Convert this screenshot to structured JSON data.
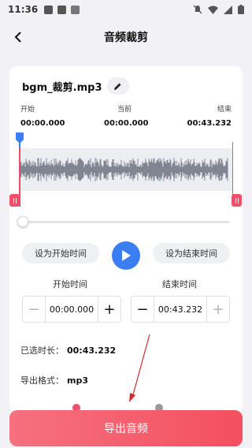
{
  "status_bar": {
    "time": "11:36"
  },
  "header": {
    "title": "音频裁剪"
  },
  "file": {
    "name": "bgm_裁剪.mp3"
  },
  "timeline": {
    "start_label": "开始",
    "current_label": "当前",
    "end_label": "结束",
    "start_value": "00:00.000",
    "current_value": "00:00.000",
    "end_value": "00:43.232"
  },
  "controls": {
    "set_start_label": "设为开始时间",
    "set_end_label": "设为结束时间"
  },
  "start_time": {
    "label": "开始时间",
    "value": "00:00.000"
  },
  "end_time": {
    "label": "结束时间",
    "value": "00:43.232"
  },
  "summary": {
    "duration_label": "已选时长：",
    "duration_value": "00:43.232",
    "format_label": "导出格式：",
    "format_value": "mp3"
  },
  "export_button": {
    "label": "导出音频"
  },
  "colors": {
    "accent_blue": "#3b7df3",
    "accent_red": "#f0506a"
  }
}
